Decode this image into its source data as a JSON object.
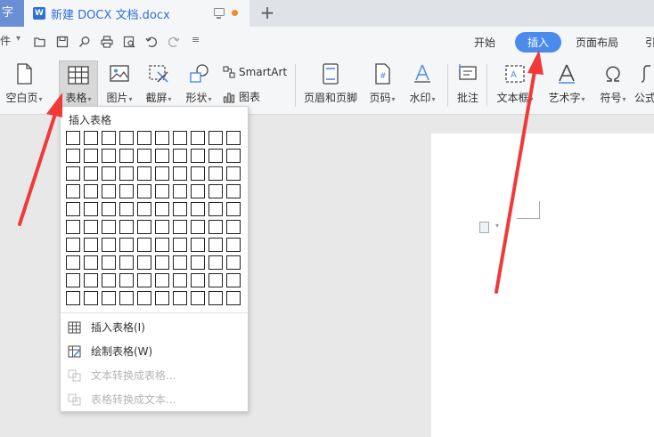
{
  "tabbar": {
    "app_tab_stub": "字",
    "doc_icon": "W",
    "doc_title": "新建 DOCX 文档.docx",
    "new_tab": "+"
  },
  "menu": {
    "file_stub": "件",
    "qa_more": "≡",
    "tabs": [
      "开始",
      "插入",
      "页面布局",
      "引"
    ],
    "active_tab": "插入"
  },
  "ribbon": {
    "blank_page": "空白页",
    "table": "表格",
    "picture": "图片",
    "screenshot": "截屏",
    "shapes": "形状",
    "smartart": "SmartArt",
    "chart": "图表",
    "header_footer": "页眉和页脚",
    "page_number": "页码",
    "watermark": "水印",
    "comment": "批注",
    "textbox": "文本框",
    "wordart": "艺术字",
    "symbol": "符号",
    "formula": "公式"
  },
  "table_menu": {
    "title": "插入表格",
    "grid_rows": 10,
    "grid_cols": 10,
    "insert_table": "插入表格(I)",
    "draw_table": "绘制表格(W)",
    "text_to_table": "文本转换成表格...",
    "table_to_text": "表格转换成文本..."
  },
  "colors": {
    "accent": "#4b8bec",
    "arrow": "#f03a3a",
    "brand_blue": "#2f6fd8"
  }
}
